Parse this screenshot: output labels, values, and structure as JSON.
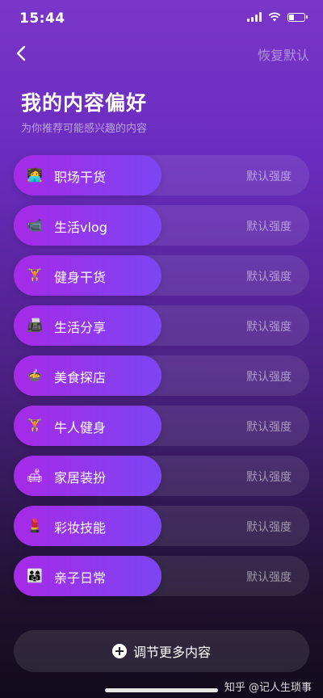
{
  "status_bar": {
    "time": "15:44",
    "battery_level": 0.35
  },
  "nav": {
    "restore_label": "恢复默认"
  },
  "header": {
    "title": "我的内容偏好",
    "subtitle": "为你推荐可能感兴趣的内容"
  },
  "categories": [
    {
      "label": "职场干货",
      "icon": "🧑‍💻",
      "icon_name": "office-worker-icon",
      "strength": "默认强度"
    },
    {
      "label": "生活vlog",
      "icon": "📹",
      "icon_name": "video-camera-icon",
      "strength": "默认强度"
    },
    {
      "label": "健身干货",
      "icon": "🏋",
      "icon_name": "weightlifting-icon",
      "strength": "默认强度"
    },
    {
      "label": "生活分享",
      "icon": "📠",
      "icon_name": "fax-machine-icon",
      "strength": "默认强度"
    },
    {
      "label": "美食探店",
      "icon": "🍲",
      "icon_name": "food-bowl-icon",
      "strength": "默认强度"
    },
    {
      "label": "牛人健身",
      "icon": "🏋",
      "icon_name": "weightlifter-icon",
      "strength": "默认强度"
    },
    {
      "label": "家居装扮",
      "icon": "🛋",
      "icon_name": "sofa-icon",
      "strength": "默认强度"
    },
    {
      "label": "彩妆技能",
      "icon": "💄",
      "icon_name": "lipstick-icon",
      "strength": "默认强度"
    },
    {
      "label": "亲子日常",
      "icon": "👨‍👩‍👧",
      "icon_name": "family-icon",
      "strength": "默认强度"
    }
  ],
  "more_button": {
    "label": "调节更多内容"
  },
  "watermark": "知乎 @记人生琐事",
  "colors": {
    "pill_start": "#a62ae8",
    "pill_end": "#7d45f2",
    "accent_bg": "#6a2cc0"
  }
}
